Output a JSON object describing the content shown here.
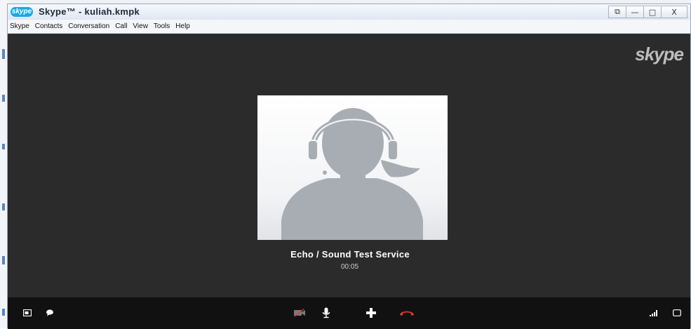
{
  "window": {
    "title": "Skype™ - kuliah.kmpk",
    "logo_text": "skype",
    "controls": [
      "restore-down",
      "minimize",
      "maximize",
      "close"
    ],
    "control_glyphs": {
      "close": "X",
      "minimize": "—",
      "maximize": "□",
      "restore": "⧉"
    }
  },
  "menubar": {
    "items": [
      {
        "label": "Skype"
      },
      {
        "label": "Contacts"
      },
      {
        "label": "Conversation"
      },
      {
        "label": "Call"
      },
      {
        "label": "View"
      },
      {
        "label": "Tools"
      },
      {
        "label": "Help"
      }
    ]
  },
  "call": {
    "watermark": "skype",
    "contact_name": "Echo / Sound Test Service",
    "duration": "00:05"
  },
  "toolbar": {
    "left": [
      "show-contacts-icon",
      "chat-icon"
    ],
    "center": [
      "video-off-icon",
      "microphone-icon",
      "add-icon",
      "end-call-icon"
    ],
    "right": [
      "signal-strength-icon",
      "fullscreen-icon"
    ],
    "colors": {
      "end_call": "#e03b2b",
      "icons": "#ffffff",
      "disabled": "#7a7a7a"
    }
  },
  "colors": {
    "stage_bg": "#2b2b2b",
    "toolbar_bg": "#111111",
    "skype_blue": "#19a9e8",
    "avatar_fill": "#a8adb4"
  }
}
